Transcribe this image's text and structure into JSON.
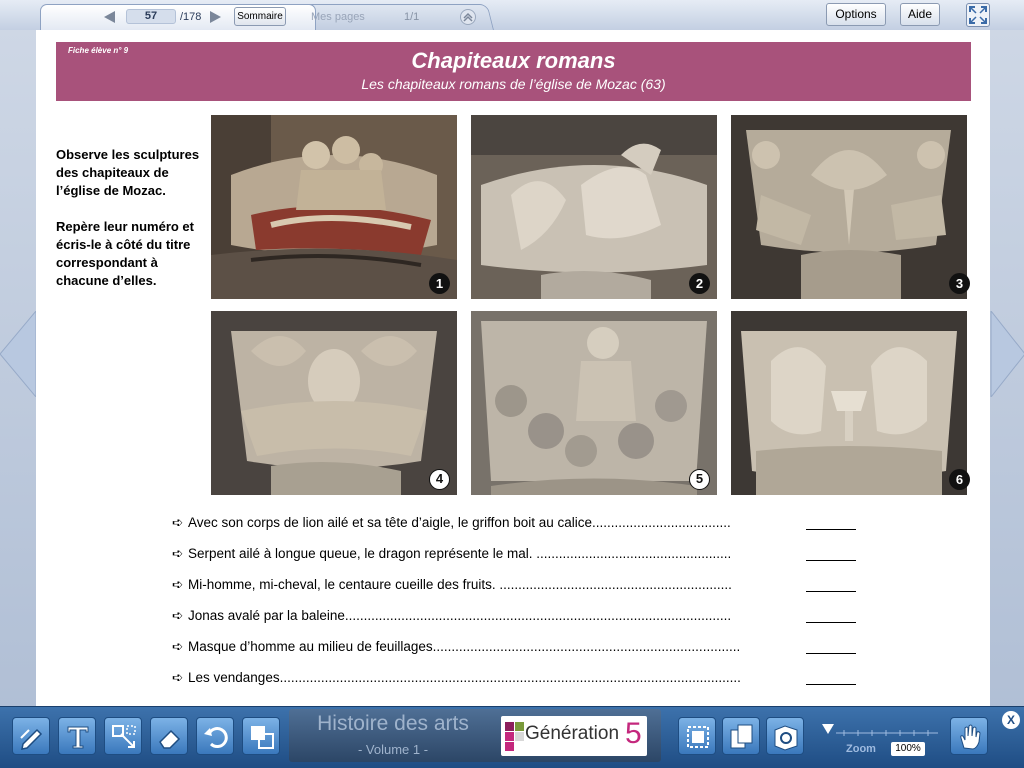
{
  "topbar": {
    "current_page": "57",
    "total_pages": "/178",
    "sommaire_label": "Sommaire",
    "mes_pages_label": "Mes pages",
    "mes_pages_count": "1/1",
    "options_label": "Options",
    "aide_label": "Aide"
  },
  "sheet": {
    "fiche_label": "Fiche élève n° 9",
    "title": "Chapiteaux romans",
    "subtitle": "Les chapiteaux romans de l’église de Mozac (63)",
    "band_color": "#a8527b",
    "instructions": [
      "Observe les sculptures des chapiteaux de l’église de Mozac.",
      "Repère leur numéro et écris-le à côté du titre correspondant à chacune d’elles."
    ],
    "photos": [
      {
        "number": "1",
        "subject": "Jonas et la baleine"
      },
      {
        "number": "2",
        "subject": "dragon"
      },
      {
        "number": "3",
        "subject": "centaure"
      },
      {
        "number": "4",
        "subject": "masque d’homme"
      },
      {
        "number": "5",
        "subject": "vendanges"
      },
      {
        "number": "6",
        "subject": "griffons au calice"
      }
    ],
    "answers": [
      "Avec son corps de lion ailé et sa tête d’aigle, le griffon boit au calice.....................................",
      "Serpent ailé à longue queue, le dragon représente le mal. ....................................................",
      "Mi-homme, mi-cheval, le centaure cueille des fruits. ..............................................................",
      "Jonas avalé par la baleine.......................................................................................................",
      "Masque d’homme au milieu de feuillages..................................................................................",
      "Les vendanges..........................................................................................................................."
    ]
  },
  "bottombar": {
    "book_title": "Histoire des arts",
    "book_volume": "- Volume 1 -",
    "publisher_name": "Génération",
    "publisher_number": "5",
    "zoom_label": "Zoom",
    "zoom_value": "100%",
    "close_label": "X",
    "tools": [
      "pencil-icon",
      "text-icon",
      "move-resize-icon",
      "eraser-icon",
      "undo-icon",
      "layers-icon",
      "select-frame-icon",
      "copy-pages-icon",
      "media-icon",
      "hand-icon"
    ]
  }
}
